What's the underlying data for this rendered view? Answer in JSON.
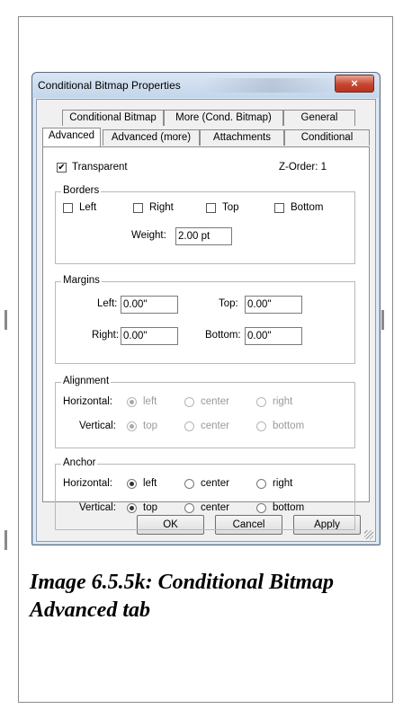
{
  "dialog": {
    "title": "Conditional Bitmap Properties",
    "close_symbol": "×",
    "tabs_row1": [
      "Conditional Bitmap",
      "More (Cond. Bitmap)",
      "General"
    ],
    "tabs_row2": [
      "Advanced",
      "Advanced (more)",
      "Attachments",
      "Conditional"
    ],
    "active_tab": "Advanced"
  },
  "transparent": {
    "label": "Transparent",
    "checked": true
  },
  "z_order": "Z-Order: 1",
  "borders": {
    "label": "Borders",
    "left": "Left",
    "right": "Right",
    "top": "Top",
    "bottom": "Bottom",
    "weight_label": "Weight:",
    "weight_value": "2.00 pt"
  },
  "margins": {
    "label": "Margins",
    "left_label": "Left:",
    "left_value": "0.00\"",
    "top_label": "Top:",
    "top_value": "0.00\"",
    "right_label": "Right:",
    "right_value": "0.00\"",
    "bottom_label": "Bottom:",
    "bottom_value": "0.00\""
  },
  "alignment": {
    "label": "Alignment",
    "horizontal_label": "Horizontal:",
    "vertical_label": "Vertical:",
    "h_options": [
      "left",
      "center",
      "right"
    ],
    "v_options": [
      "top",
      "center",
      "bottom"
    ]
  },
  "anchor": {
    "label": "Anchor",
    "horizontal_label": "Horizontal:",
    "vertical_label": "Vertical:",
    "h_options": [
      "left",
      "center",
      "right"
    ],
    "v_options": [
      "top",
      "center",
      "bottom"
    ]
  },
  "buttons": {
    "ok": "OK",
    "cancel": "Cancel",
    "apply": "Apply"
  },
  "caption": "Image 6.5.5k: Conditional Bitmap Advanced tab"
}
